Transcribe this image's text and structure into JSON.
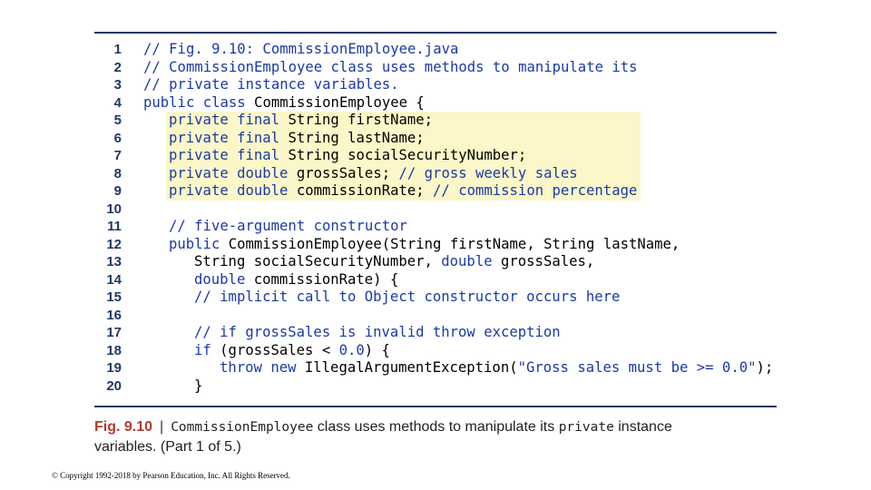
{
  "listing": {
    "line_numbers": [
      "1",
      "2",
      "3",
      "4",
      "5",
      "6",
      "7",
      "8",
      "9",
      "10",
      "11",
      "12",
      "13",
      "14",
      "15",
      "16",
      "17",
      "18",
      "19",
      "20"
    ],
    "highlight_color": "#fbf7c8",
    "code": {
      "l1": "// Fig. 9.10: CommissionEmployee.java",
      "l2": "// CommissionEmployee class uses methods to manipulate its",
      "l3": "// private instance variables.",
      "l4_kw": "public class",
      "l4_rest": " CommissionEmployee {",
      "l5_kw": "private final",
      "l5_rest": " String firstName;",
      "l6_kw": "private final",
      "l6_rest": " String lastName;",
      "l7_kw": "private final",
      "l7_rest": " String socialSecurityNumber;",
      "l8_kw": "private double",
      "l8_rest": " grossSales; ",
      "l8_cm": "// gross weekly sales",
      "l9_kw": "private double",
      "l9_rest": " commissionRate; ",
      "l9_cm": "// commission percentage",
      "l11": "// five-argument constructor",
      "l12_kw": "public",
      "l12_rest": " CommissionEmployee(String firstName, String lastName,",
      "l13_a": "String socialSecurityNumber, ",
      "l13_kw": "double",
      "l13_b": " grossSales,",
      "l14_kw": "double",
      "l14_rest": " commissionRate) {",
      "l15": "// implicit call to Object constructor occurs here",
      "l17": "// if grossSales is invalid throw exception",
      "l18_kw": "if",
      "l18_a": " (grossSales < ",
      "l18_num": "0.0",
      "l18_b": ") {",
      "l19_kw": "throw new",
      "l19_a": " IllegalArgumentException(",
      "l19_str": "\"Gross sales must be >= 0.0\"",
      "l19_b": ");",
      "l20": "}"
    }
  },
  "caption": {
    "fig_label": "Fig. 9.10",
    "separator": "|",
    "class_name": "CommissionEmployee",
    "text_1": " class uses methods to manipulate its ",
    "keyword": "private",
    "text_2": " instance",
    "line_2": "variables. (Part 1 of 5.)"
  },
  "copyright": "© Copyright 1992-2018 by Pearson Education, Inc. All Rights Reserved."
}
